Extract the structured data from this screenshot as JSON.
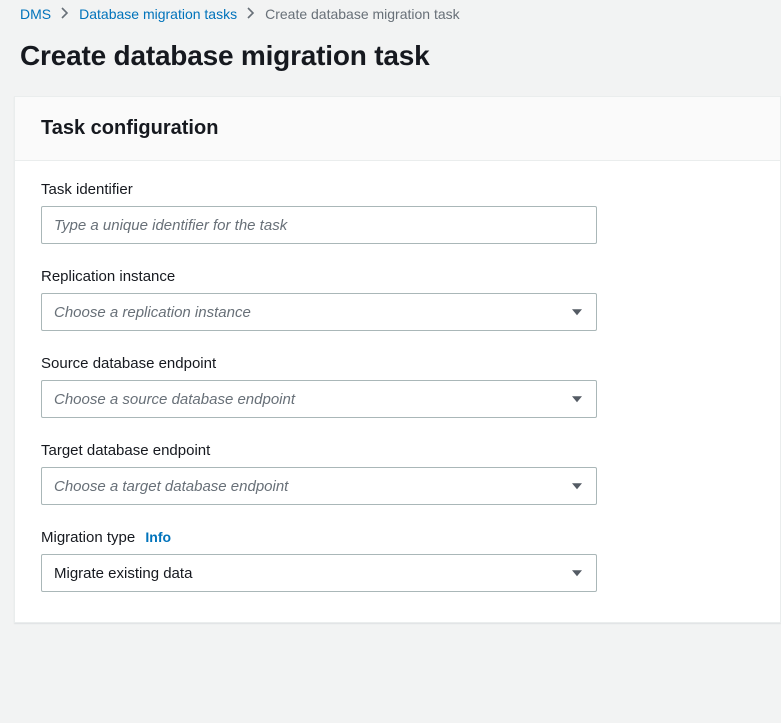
{
  "breadcrumb": {
    "root": "DMS",
    "tasks": "Database migration tasks",
    "current": "Create database migration task"
  },
  "page_title": "Create database migration task",
  "panel": {
    "title": "Task configuration",
    "fields": {
      "task_identifier": {
        "label": "Task identifier",
        "placeholder": "Type a unique identifier for the task",
        "value": ""
      },
      "replication_instance": {
        "label": "Replication instance",
        "placeholder": "Choose a replication instance",
        "value": ""
      },
      "source_endpoint": {
        "label": "Source database endpoint",
        "placeholder": "Choose a source database endpoint",
        "value": ""
      },
      "target_endpoint": {
        "label": "Target database endpoint",
        "placeholder": "Choose a target database endpoint",
        "value": ""
      },
      "migration_type": {
        "label": "Migration type",
        "info": "Info",
        "value": "Migrate existing data"
      }
    }
  }
}
